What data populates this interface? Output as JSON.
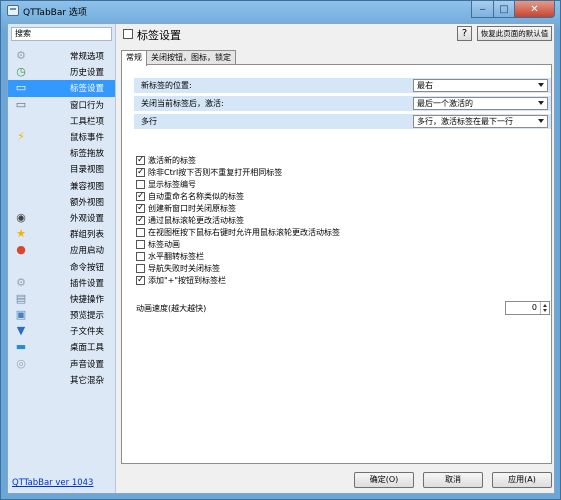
{
  "window": {
    "title": "QTTabBar 选项"
  },
  "sidebar": {
    "search_placeholder": "搜索",
    "items": [
      {
        "label": "常规选项",
        "icon": "gear-icon",
        "glyph": "⚙",
        "color": "#9aa4ae"
      },
      {
        "label": "历史设置",
        "icon": "history-icon",
        "glyph": "◷",
        "color": "#3a9a3a"
      },
      {
        "label": "标签设置",
        "icon": "tab-settings-icon",
        "glyph": "▭",
        "color": "#ffffff"
      },
      {
        "label": "窗口行为",
        "icon": "window-icon",
        "glyph": "▭",
        "color": "#5a6a7a"
      },
      {
        "label": "工具栏项",
        "icon": "",
        "glyph": "",
        "color": ""
      },
      {
        "label": "鼠标事件",
        "icon": "lightning-icon",
        "glyph": "⚡",
        "color": "#f2b400"
      },
      {
        "label": "标签拖放",
        "icon": "",
        "glyph": "",
        "color": ""
      },
      {
        "label": "目录视图",
        "icon": "",
        "glyph": "",
        "color": ""
      },
      {
        "label": "兼容视图",
        "icon": "",
        "glyph": "",
        "color": ""
      },
      {
        "label": "额外视图",
        "icon": "",
        "glyph": "",
        "color": ""
      },
      {
        "label": "外观设置",
        "icon": "eye-icon",
        "glyph": "◉",
        "color": "#444444"
      },
      {
        "label": "群组列表",
        "icon": "star-icon",
        "glyph": "★",
        "color": "#f0b400"
      },
      {
        "label": "应用启动",
        "icon": "app-launch-icon",
        "glyph": "●",
        "color": "#d9472b"
      },
      {
        "label": "命令按钮",
        "icon": "",
        "glyph": "",
        "color": ""
      },
      {
        "label": "插件设置",
        "icon": "plugin-icon",
        "glyph": "⚙",
        "color": "#9aa4ae"
      },
      {
        "label": "快捷操作",
        "icon": "keyboard-icon",
        "glyph": "▤",
        "color": "#6f88a6"
      },
      {
        "label": "预览提示",
        "icon": "preview-icon",
        "glyph": "▣",
        "color": "#4a7fc0"
      },
      {
        "label": "子文件夹",
        "icon": "subfolder-icon",
        "glyph": "▼",
        "color": "#2b6cc4"
      },
      {
        "label": "桌面工具",
        "icon": "desktop-icon",
        "glyph": "▬",
        "color": "#2a8ad8"
      },
      {
        "label": "声音设置",
        "icon": "sound-icon",
        "glyph": "◎",
        "color": "#9aa4ae"
      },
      {
        "label": "其它混杂",
        "icon": "",
        "glyph": "",
        "color": ""
      }
    ],
    "selected_index": 2,
    "version_link": "QTTabBar ver 1043"
  },
  "main": {
    "title": "标签设置",
    "help_label": "?",
    "restore_label": "恢复此页面的默认值",
    "tabs": [
      "常规",
      "关闭按钮，图标，锁定"
    ],
    "active_tab": 0,
    "settings": [
      {
        "label": "新标签的位置:",
        "value": "最右"
      },
      {
        "label": "关闭当前标签后，激活:",
        "value": "最后一个激活的"
      },
      {
        "label": "多行",
        "value": "多行，激活标签在最下一行"
      }
    ],
    "checkboxes": [
      {
        "label": "激活新的标签",
        "checked": true
      },
      {
        "label": "除非Ctrl按下否则不重复打开相同标签",
        "checked": true
      },
      {
        "label": "显示标签编号",
        "checked": false
      },
      {
        "label": "自动重命名名称类似的标签",
        "checked": true
      },
      {
        "label": "创建新窗口时关闭原标签",
        "checked": true
      },
      {
        "label": "通过鼠标滚轮更改活动标签",
        "checked": true
      },
      {
        "label": "在视图框按下鼠标右键时允许用鼠标滚轮更改活动标签",
        "checked": false
      },
      {
        "label": "标签动画",
        "checked": false
      },
      {
        "label": "水平翻转标签栏",
        "checked": false
      },
      {
        "label": "导航失败时关闭标签",
        "checked": false
      },
      {
        "label": "添加\"+\"按钮到标签栏",
        "checked": true
      }
    ],
    "animation": {
      "label": "动画速度(越大越快)",
      "value": "0"
    }
  },
  "footer": {
    "ok": "确定(O)",
    "cancel": "取消",
    "apply": "应用(A)"
  }
}
